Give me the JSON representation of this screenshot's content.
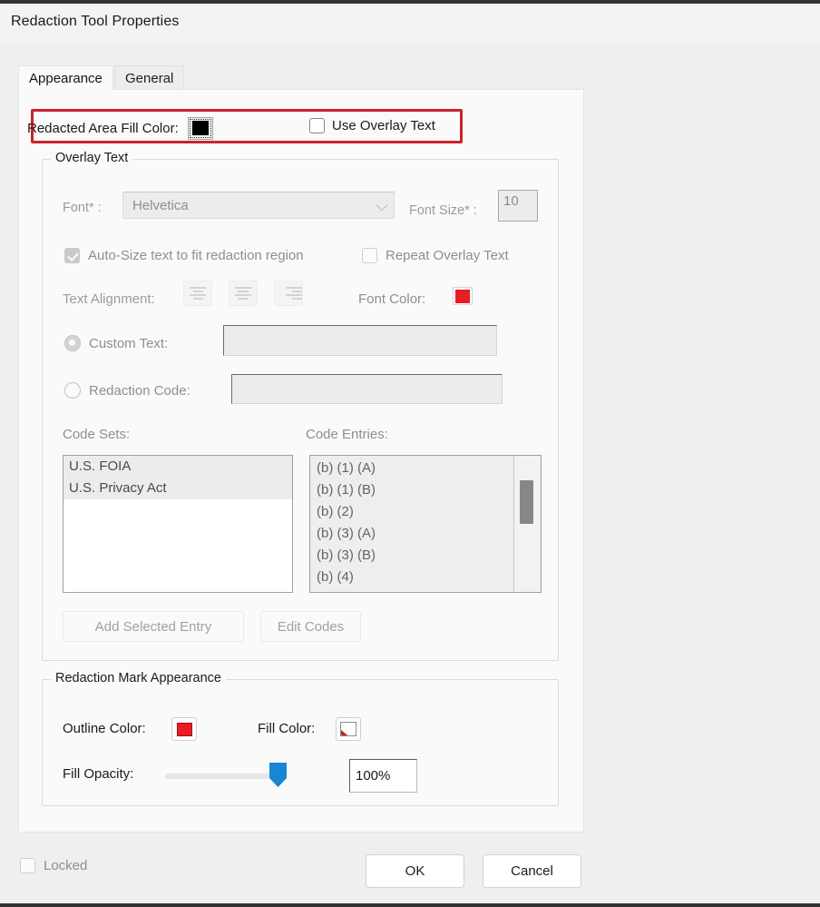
{
  "window": {
    "title": "Redaction Tool Properties"
  },
  "tabs": [
    {
      "label": "Appearance",
      "active": true
    },
    {
      "label": "General",
      "active": false
    }
  ],
  "fill_color_row": {
    "label": "Redacted Area Fill Color:",
    "swatch_color": "#000000",
    "use_overlay_text_label": "Use Overlay Text",
    "use_overlay_text_checked": false,
    "highlight_color": "#cc2229"
  },
  "overlay_text_group": {
    "title": "Overlay Text",
    "font_label": "Font* :",
    "font_value": "Helvetica",
    "font_size_label": "Font Size* :",
    "font_size_value": "10",
    "auto_size_label": "Auto-Size text to fit redaction region",
    "auto_size_checked": true,
    "repeat_overlay_label": "Repeat Overlay Text",
    "repeat_overlay_checked": false,
    "text_alignment_label": "Text Alignment:",
    "alignment_options": [
      "align-left",
      "align-center",
      "align-right"
    ],
    "font_color_label": "Font Color:",
    "font_color_value": "#ec1c24",
    "custom_text_label": "Custom Text:",
    "custom_text_selected": true,
    "custom_text_value": "",
    "redaction_code_label": "Redaction Code:",
    "redaction_code_selected": false,
    "redaction_code_value": "",
    "code_sets_label": "Code Sets:",
    "code_entries_label": "Code Entries:",
    "code_sets": [
      "U.S. FOIA",
      "U.S. Privacy Act"
    ],
    "code_entries": [
      "(b) (1) (A)",
      "(b) (1) (B)",
      "(b) (2)",
      "(b) (3) (A)",
      "(b) (3) (B)",
      "(b) (4)"
    ],
    "add_selected_entry_label": "Add Selected Entry",
    "edit_codes_label": "Edit Codes"
  },
  "mark_appearance_group": {
    "title": "Redaction Mark Appearance",
    "outline_color_label": "Outline Color:",
    "outline_color_value": "#ee1b24",
    "fill_color_label": "Fill Color:",
    "fill_color_value": "none",
    "fill_opacity_label": "Fill Opacity:",
    "fill_opacity_value": "100%",
    "fill_opacity_percent": 100
  },
  "footer": {
    "locked_label": "Locked",
    "locked_checked": false,
    "ok_label": "OK",
    "cancel_label": "Cancel"
  }
}
